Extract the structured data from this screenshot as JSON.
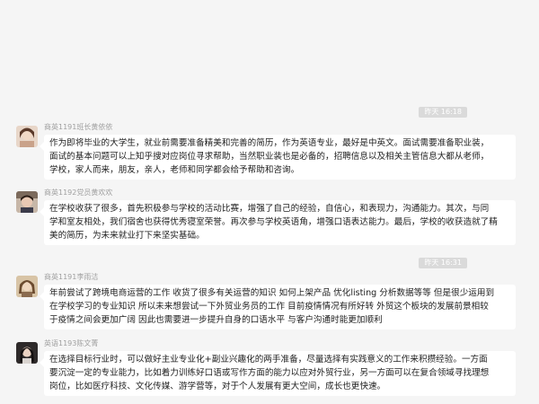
{
  "timestamps": [
    "昨天 16:18",
    "昨天 16:31"
  ],
  "messages": [
    {
      "sender": "商英1191班长黄依依",
      "lines": [
        "作为即将毕业的大学生，就业前需要准备精美和完善的简历，作为英语专业，最好是中英文。面试需要准备职业装，",
        "面试的基本问题可以上知乎搜对应岗位寻求帮助，当然职业装也是必备的，招聘信息以及相关主管信息大都从老师，",
        "学校，家人而来，朋友，亲人，老师和同学都会给予帮助和咨询。"
      ]
    },
    {
      "sender": "商英1192党员黄欢欢",
      "lines": [
        "在学校收获了很多，首先积极参与学校的活动比赛，增强了自己的经验，自信心，和表现力，沟通能力。其次，与同",
        "学和室友相处，我们宿舍也获得优秀寝室荣誉。再次参与学校英语角，增强口语表达能力。最后，学校的收获造就了精",
        "美的简历，为未来就业打下来坚实基础。"
      ]
    },
    {
      "sender": "商英1191李雨洁",
      "lines": [
        "年前尝试了跨境电商运营的工作 收货了很多有关运营的知识 如何上架产品 优化listing 分析数据等等 但是很少运用到",
        "在学校学习的专业知识 所以未来想尝试一下外贸业务员的工作 目前疫情情况有所好转 外贸这个板块的发展前景相较",
        "于疫情之间会更加广阔 因此也需要进一步提升自身的口语水平 与客户沟通时能更加顺利"
      ]
    },
    {
      "sender": "英语1193陈文菁",
      "lines": [
        "在选择目标行业时，可以做好主业专业化+副业兴趣化的两手准备，尽量选择有实践意义的工作来积攒经验。一方面",
        "要沉淀一定的专业能力，比如着力训练好口语或写作方面的能力以应对外贸行业，另一方面可以在复合领域寻找理想",
        "岗位，比如医疗科技、文化传媒、游学营等，对于个人发展有更大空间，成长也更快速。"
      ]
    }
  ],
  "colors": {
    "background": "#f5f5f5",
    "bubble": "#ffffff",
    "timestamp_pill": "#dadada",
    "sender_text": "#a0a0a0"
  }
}
